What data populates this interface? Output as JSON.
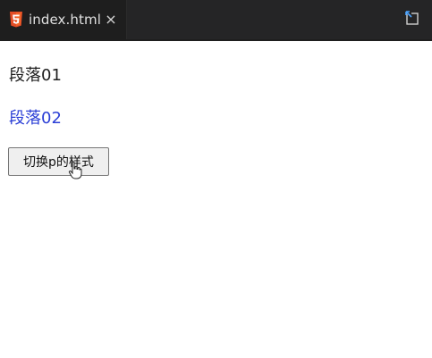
{
  "editor": {
    "tab": {
      "filename": "index.html",
      "close_glyph": "×",
      "icon": "html5-icon"
    },
    "actions": {
      "open_external_icon": "open-in-browser-icon"
    }
  },
  "preview": {
    "paragraph_1": "段落01",
    "paragraph_2": "段落02",
    "toggle_button_label": "切换p的样式"
  },
  "colors": {
    "titlebar_bg": "#252526",
    "tab_bg": "#1e1e1e",
    "html5_orange": "#e44d26",
    "paragraph_2": "#2b3fd6"
  }
}
